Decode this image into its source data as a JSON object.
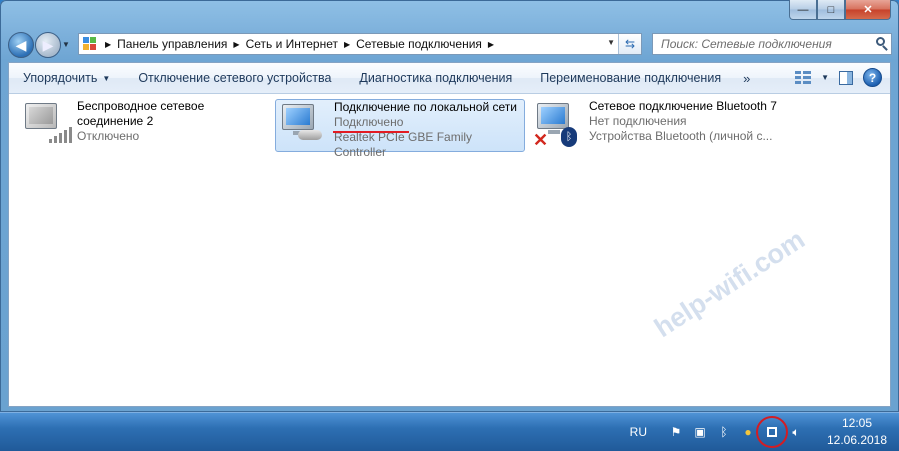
{
  "window": {
    "caption_buttons": {
      "minimize": "—",
      "maximize": "□",
      "close": "✕"
    }
  },
  "navbar": {
    "breadcrumb": [
      "Панель управления",
      "Сеть и Интернет",
      "Сетевые подключения"
    ],
    "search_placeholder": "Поиск: Сетевые подключения"
  },
  "toolbar": {
    "organize": "Упорядочить",
    "disable_device": "Отключение сетевого устройства",
    "diagnose": "Диагностика подключения",
    "rename": "Переименование подключения",
    "more": "»"
  },
  "connections": [
    {
      "name": "Беспроводное сетевое",
      "name2": "соединение 2",
      "status": "Отключено",
      "device": "",
      "icon": "wireless-icon"
    },
    {
      "name": "Подключение по локальной сети",
      "status": "Подключено",
      "device": "Realtek PCIe GBE Family Controller",
      "icon": "ethernet-icon",
      "selected": true
    },
    {
      "name": "Сетевое подключение Bluetooth 7",
      "status": "Нет подключения",
      "device": "Устройства Bluetooth (личной с...",
      "icon": "bluetooth-icon"
    }
  ],
  "watermark": "help-wifi.com",
  "taskbar": {
    "language": "RU",
    "time": "12:05",
    "date": "12.06.2018"
  },
  "accent": {
    "selection": "#cde3f9",
    "highlight_red": "#e21b23"
  }
}
